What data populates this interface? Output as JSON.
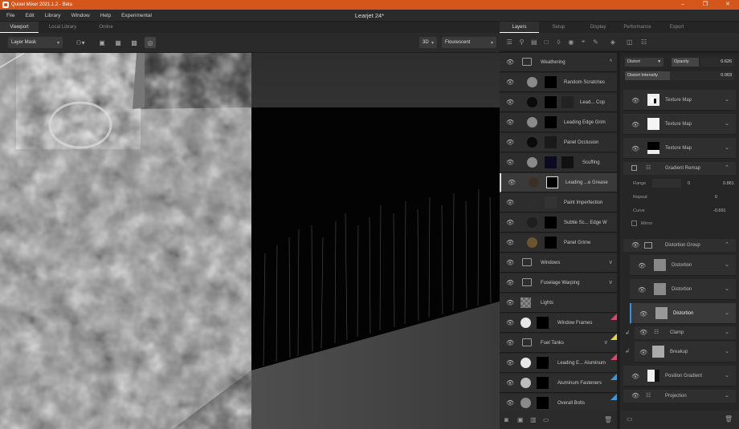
{
  "titlebar": {
    "title": "Quixel Mixer 2021.1.2 - Beta",
    "minimize": "–",
    "maximize": "❐",
    "close": "✕"
  },
  "menu": {
    "items": [
      "File",
      "Edit",
      "Library",
      "Window",
      "Help",
      "Experimental"
    ],
    "document_title": "Learjet 24*"
  },
  "left_tabs": [
    "Viewport",
    "Local Library",
    "Online"
  ],
  "viewport_toolbar": {
    "mode": "Layer Mask",
    "view_mode": "3D",
    "lighting": "Flourescent"
  },
  "right_tabs": [
    "Layers",
    "Setup",
    "Display",
    "Performance",
    "Export"
  ],
  "layers": [
    {
      "name": "Weathering",
      "kind": "folder",
      "caret": "^"
    },
    {
      "name": "Random Scratches",
      "kind": "layer",
      "swatch": "#8a8a8a"
    },
    {
      "name": "Lead... Cop",
      "kind": "layer",
      "swatch": "#0b0b0b"
    },
    {
      "name": "Leading Edge Grim",
      "kind": "layer",
      "swatch": "#8a8a8a"
    },
    {
      "name": "Panel Occlusion",
      "kind": "layer",
      "swatch": "#0b0b0b"
    },
    {
      "name": "Scuffing",
      "kind": "layer",
      "swatch": "#8a8a8a"
    },
    {
      "name": "Leading ...e Grease",
      "kind": "layer",
      "swatch": "#3a3026",
      "selected": true
    },
    {
      "name": "Paint Imperfection",
      "kind": "layer",
      "swatch": "#2e2e2e"
    },
    {
      "name": "Subtle Sc... Edge W",
      "kind": "layer",
      "swatch": "#1e1e1e"
    },
    {
      "name": "Panel Grime",
      "kind": "layer",
      "swatch": "#6b5530"
    },
    {
      "name": "Windows",
      "kind": "folder",
      "caret": "v"
    },
    {
      "name": "Fuselage Warping",
      "kind": "folder",
      "caret": "v"
    },
    {
      "name": "Lights",
      "kind": "checker"
    },
    {
      "name": "Window Frames",
      "kind": "layer",
      "swatch": "#e8e8e8",
      "flag": "#e0446a"
    },
    {
      "name": "Fuel Tanks",
      "kind": "folder",
      "caret": "v",
      "flag": "#e8d83a"
    },
    {
      "name": "Leading E... Aluminum",
      "kind": "layer",
      "swatch": "#e8e8e8",
      "flag": "#e0446a"
    },
    {
      "name": "Aluminum Fasteners",
      "kind": "layer",
      "swatch": "#bdbdbd",
      "flag": "#3a9ae0"
    },
    {
      "name": "Overall Bolts",
      "kind": "layer",
      "swatch": "#8a8a8a",
      "flag": "#3a9ae0"
    }
  ],
  "props": {
    "blend_mode": "Distort",
    "opacity_label": "Opacity",
    "opacity_value": "0.626",
    "distort_intensity_label": "Distort Intensity",
    "distort_intensity_value": "0.003",
    "texture_maps": [
      "Texture Map",
      "Texture Map",
      "Texture Map"
    ],
    "gradient_remap": {
      "label": "Gradient Remap",
      "range_label": "Range",
      "range_min": "0",
      "range_max": "0.881",
      "repeat_label": "Repeat",
      "repeat_value": "0",
      "curve_label": "Curve",
      "curve_value": "-0.691",
      "mirror_label": "Mirror"
    },
    "distortion_group": "Distortion Group",
    "distortions": [
      "Distortion",
      "Distortion",
      "Distortion"
    ],
    "clamp": "Clamp",
    "breakup": "Breakup",
    "position_gradient": "Position Gradient",
    "projection": "Projection"
  }
}
